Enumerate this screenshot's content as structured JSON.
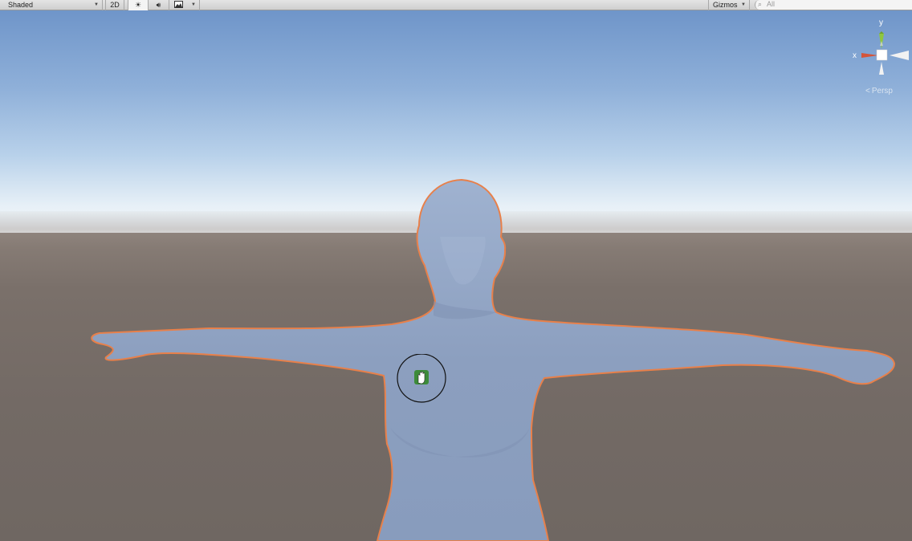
{
  "toolbar": {
    "draw_mode": "Shaded",
    "btn_2d": "2D",
    "gizmos": "Gizmos",
    "search_placeholder": "All",
    "icons": {
      "dropdown": "caret-down-icon",
      "lighting": "sun-icon",
      "audio": "speaker-icon",
      "effects": "image-icon",
      "search": "search-icon"
    }
  },
  "scene": {
    "axis_labels": {
      "x": "x",
      "y": "y"
    },
    "projection": "Persp",
    "axis_colors": {
      "x": "#d4553a",
      "y": "#8ec63f",
      "z": "#ffffff"
    },
    "selection_outline": "#e8804a",
    "model_color": "#8ea2c2",
    "tool_icon": "hand-pan-icon",
    "tool_icon_color": "#3d8b3a"
  }
}
